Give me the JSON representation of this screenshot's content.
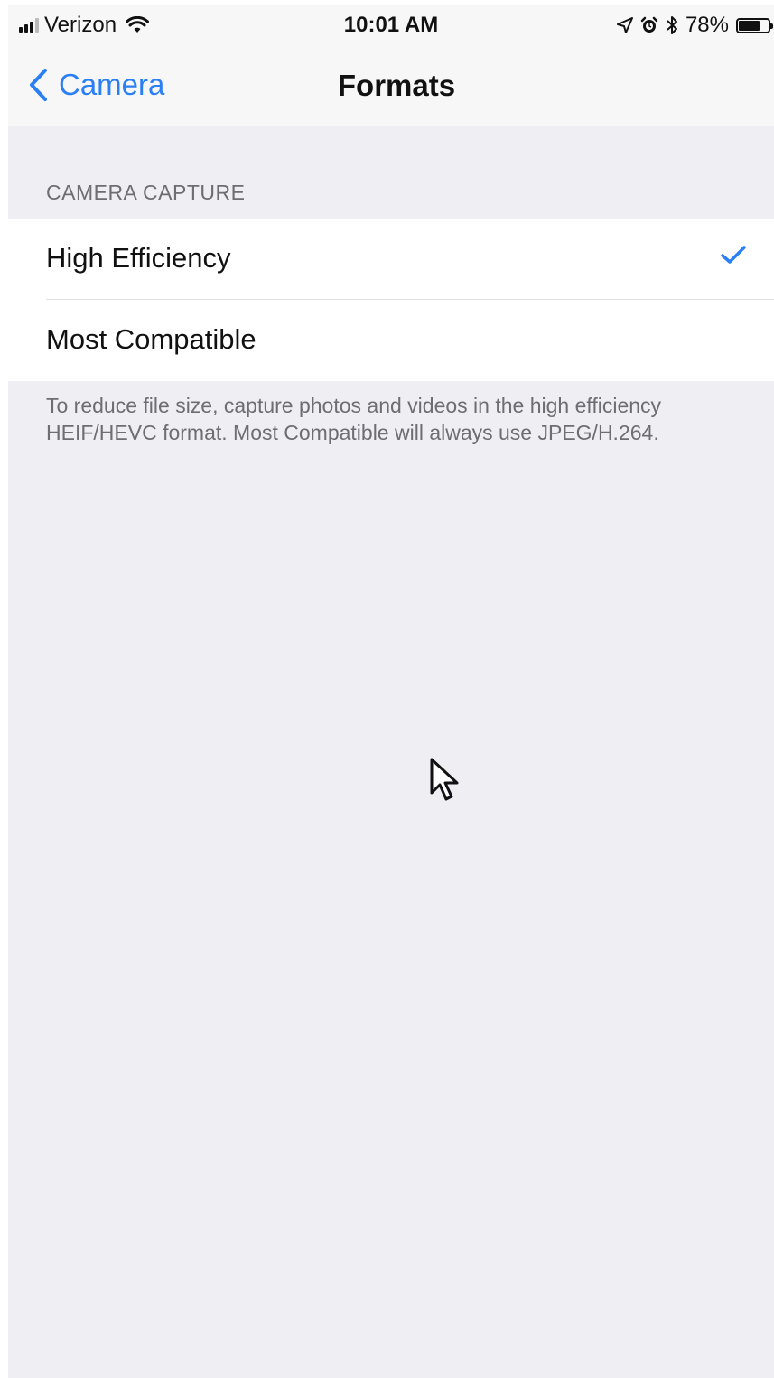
{
  "status_bar": {
    "carrier": "Verizon",
    "time": "10:01 AM",
    "battery": "78%",
    "battery_level": 0.78
  },
  "nav": {
    "back_label": "Camera",
    "title": "Formats"
  },
  "section": {
    "header": "CAMERA CAPTURE",
    "options": [
      {
        "label": "High Efficiency",
        "selected": true
      },
      {
        "label": "Most Compatible",
        "selected": false
      }
    ],
    "footer": "To reduce file size, capture photos and videos in the high efficiency HEIF/HEVC format. Most Compatible will always use JPEG/H.264."
  },
  "colors": {
    "accent": "#2a7ff6",
    "background": "#efeef3"
  }
}
